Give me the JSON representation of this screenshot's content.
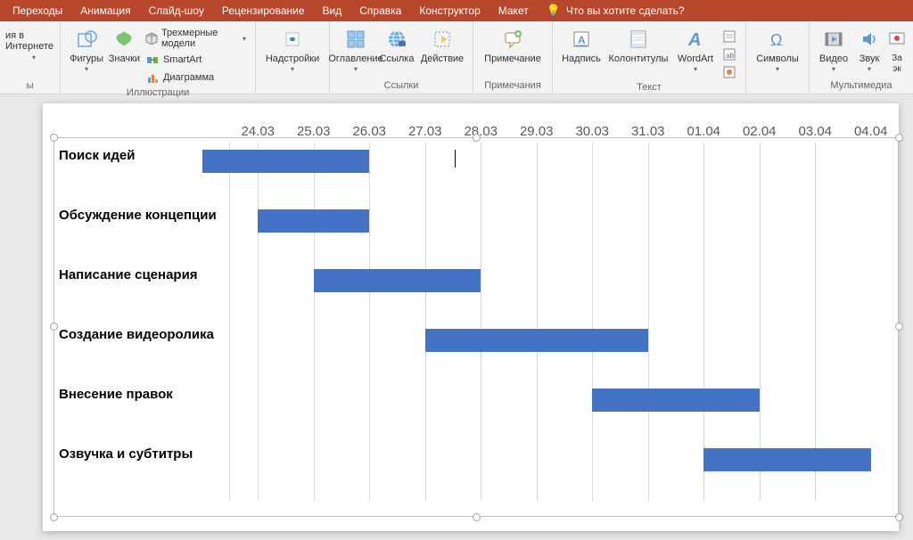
{
  "ribbon": {
    "tabs": [
      "Переходы",
      "Анимация",
      "Слайд-шоу",
      "Рецензирование",
      "Вид",
      "Справка",
      "Конструктор",
      "Макет"
    ],
    "tellme": "Что вы хотите сделать?",
    "cutoff_left": "ия в Интернете",
    "groups": {
      "illustrations": {
        "label": "Иллюстрации",
        "shapes": "Фигуры",
        "icons": "Значки",
        "models3d": "Трехмерные модели",
        "smartart": "SmartArt",
        "chart": "Диаграмма"
      },
      "addins": {
        "label": "Надстройки"
      },
      "links": {
        "label": "Ссылки",
        "toc": "Оглавление",
        "link": "Ссылка",
        "action": "Действие"
      },
      "comments": {
        "label": "Примечания",
        "comment": "Примечание"
      },
      "text": {
        "label": "Текст",
        "textbox": "Надпись",
        "headerfooter": "Колонтитулы",
        "wordart": "WordArt"
      },
      "symbols": {
        "label": "",
        "symbols_btn": "Символы"
      },
      "media": {
        "label": "Мультимедиа",
        "video": "Видео",
        "audio": "Звук",
        "rec": "За\nэк"
      }
    }
  },
  "chart_data": {
    "type": "bar",
    "dates": [
      "24.03",
      "25.03",
      "26.03",
      "27.03",
      "28.03",
      "29.03",
      "30.03",
      "31.03",
      "01.04",
      "02.04",
      "03.04",
      "04.04"
    ],
    "tasks": [
      {
        "name": "Поиск идей",
        "start": 0,
        "span": 3
      },
      {
        "name": "Обсуждение концепции",
        "start": 1,
        "span": 2
      },
      {
        "name": "Написание сценария",
        "start": 2,
        "span": 3
      },
      {
        "name": "Создание видеоролика",
        "start": 4,
        "span": 4
      },
      {
        "name": "Внесение правок",
        "start": 7,
        "span": 3
      },
      {
        "name": "Озвучка и субтитры",
        "start": 9,
        "span": 3
      }
    ],
    "title": "",
    "xlabel": "",
    "ylabel": ""
  }
}
